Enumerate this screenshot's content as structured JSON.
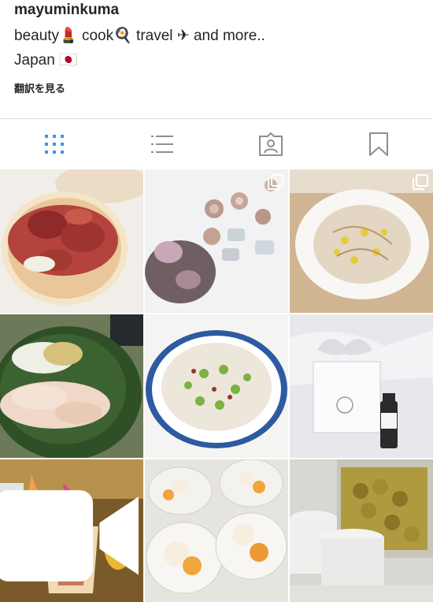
{
  "profile": {
    "username": "mayuminkuma",
    "bio_line1": "beauty💄 cook🍳 travel ✈ and more..",
    "bio_line2": "Japan 🇯🇵",
    "translate_label": "翻訳を見る"
  },
  "tabs": [
    {
      "name": "grid",
      "icon": "grid-icon",
      "active": true
    },
    {
      "name": "list",
      "icon": "list-icon",
      "active": false
    },
    {
      "name": "tagged",
      "icon": "tagged-person-icon",
      "active": false
    },
    {
      "name": "saved",
      "icon": "bookmark-icon",
      "active": false
    }
  ],
  "colors": {
    "accent": "#3897f0",
    "icon_inactive": "#8e8e8e",
    "divider": "#dbdbdb"
  },
  "posts": [
    {
      "subject": "fig toast",
      "multi": false,
      "video": false
    },
    {
      "subject": "cosmetic jars with flowers",
      "multi": true,
      "video": false
    },
    {
      "subject": "quinoa corn salad",
      "multi": true,
      "video": false
    },
    {
      "subject": "chicken on leaf",
      "multi": false,
      "video": false
    },
    {
      "subject": "edamame rice bowl",
      "multi": false,
      "video": false
    },
    {
      "subject": "HACCI box and bottle",
      "multi": false,
      "video": false
    },
    {
      "subject": "HACCI dessert cup",
      "multi": false,
      "video": true
    },
    {
      "subject": "jelly dessert cups",
      "multi": false,
      "video": false
    },
    {
      "subject": "plum syrup jars",
      "multi": false,
      "video": false
    }
  ]
}
